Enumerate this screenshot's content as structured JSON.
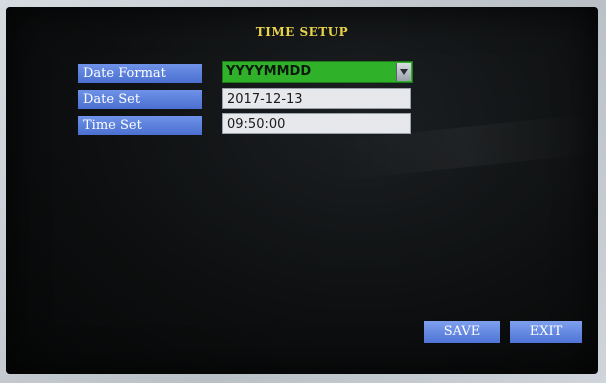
{
  "title": "TIME SETUP",
  "fields": {
    "date_format": {
      "label": "Date Format",
      "value": "YYYYMMDD"
    },
    "date_set": {
      "label": "Date Set",
      "value": "2017-12-13"
    },
    "time_set": {
      "label": "Time Set",
      "value": "09:50:00"
    }
  },
  "buttons": {
    "save": "SAVE",
    "exit": "EXIT"
  },
  "colors": {
    "label_bg": "#5a7fdc",
    "select_bg": "#2fb22a",
    "title": "#e8d24a",
    "field_bg": "#e6e8ec"
  },
  "icons": {
    "dropdown": "chevron-down-icon"
  }
}
